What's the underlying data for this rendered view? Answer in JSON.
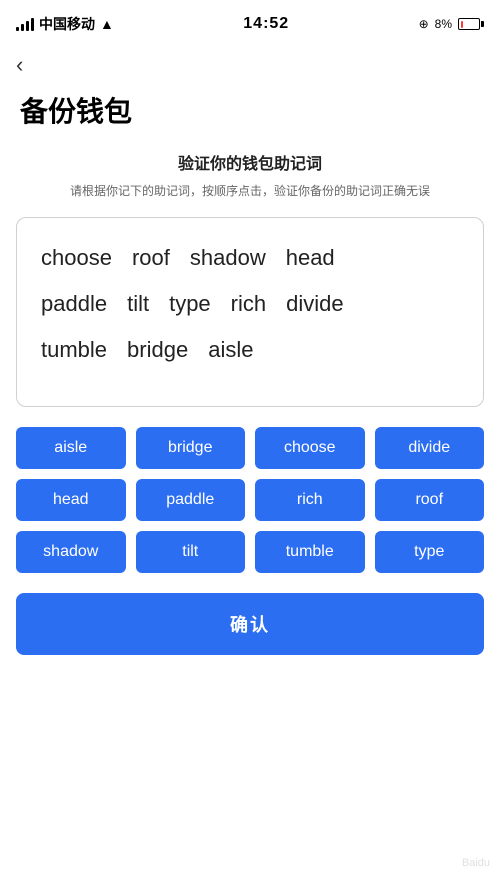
{
  "statusBar": {
    "carrier": "中国移动",
    "time": "14:52",
    "battery": "8%"
  },
  "page": {
    "backLabel": "‹",
    "title": "备份钱包",
    "sectionTitle": "验证你的钱包助记词",
    "sectionDesc": "请根据你记下的助记词，按顺序点击，验证你备份的助记词正确无误"
  },
  "displayWords": {
    "row1": [
      "choose",
      "roof",
      "shadow",
      "head"
    ],
    "row2": [
      "paddle",
      "tilt",
      "type",
      "rich",
      "divide"
    ],
    "row3": [
      "tumble",
      "bridge",
      "aisle"
    ]
  },
  "chips": [
    "aisle",
    "bridge",
    "choose",
    "divide",
    "head",
    "paddle",
    "rich",
    "roof",
    "shadow",
    "tilt",
    "tumble",
    "type"
  ],
  "confirmBtn": "确认"
}
